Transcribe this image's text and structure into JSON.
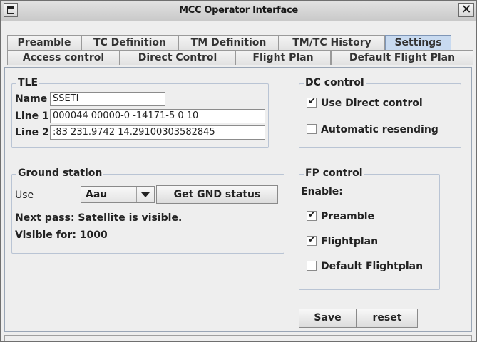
{
  "window": {
    "title": "MCC Operator Interface",
    "close_glyph": "✕"
  },
  "tabs_row1": [
    {
      "label": "Preamble",
      "selected": false
    },
    {
      "label": "TC Definition",
      "selected": false
    },
    {
      "label": "TM Definition",
      "selected": false
    },
    {
      "label": "TM/TC History",
      "selected": false
    },
    {
      "label": "Settings",
      "selected": true
    }
  ],
  "tabs_row2": [
    {
      "label": "Access control"
    },
    {
      "label": "Direct Control"
    },
    {
      "label": "Flight Plan"
    },
    {
      "label": "Default Flight Plan"
    }
  ],
  "tle": {
    "title": "TLE",
    "name_label": "Name",
    "name_value": "SSETI",
    "line1_label": "Line 1",
    "line1_value": "000044  00000-0 -14171-5 0    10",
    "line2_label": "Line 2",
    "line2_value": ":83 231.9742 14.29100303582845"
  },
  "ground_station": {
    "title": "Ground station",
    "use_label": "Use",
    "station_selected": "Aau",
    "get_status_label": "Get GND status",
    "next_pass": "Next pass: Satellite is visible.",
    "visible_for": "Visible for: 1000"
  },
  "dc_control": {
    "title": "DC control",
    "use_direct": {
      "label": "Use Direct control",
      "checked": true
    },
    "auto_resend": {
      "label": "Automatic resending",
      "checked": false
    }
  },
  "fp_control": {
    "title": "FP control",
    "enable_label": "Enable:",
    "preamble": {
      "label": "Preamble",
      "checked": true
    },
    "flightplan": {
      "label": "Flightplan",
      "checked": true
    },
    "default_flightplan": {
      "label": "Default Flightplan",
      "checked": false
    }
  },
  "actions": {
    "save_label": "Save",
    "reset_label": "reset"
  },
  "colors": {
    "selected_tab": "#c8daf0",
    "group_border": "#b9c4d4"
  }
}
